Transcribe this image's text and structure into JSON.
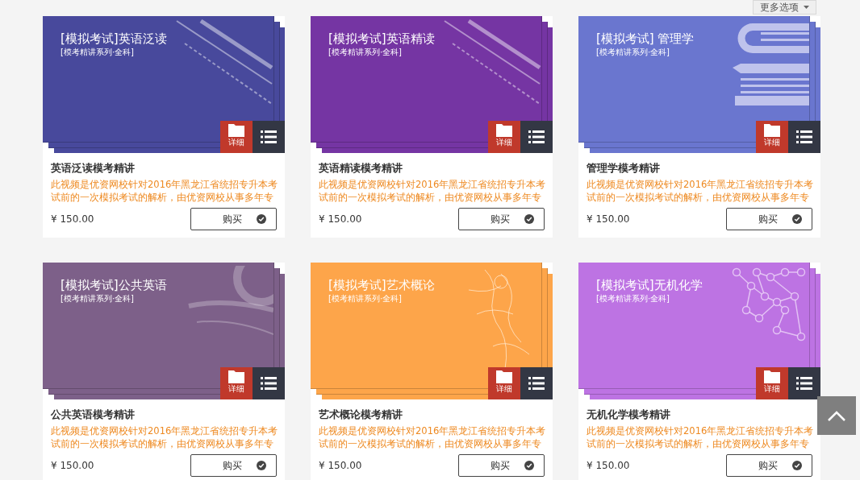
{
  "toolbar": {
    "options_button": "更多选项"
  },
  "courses": [
    {
      "cover_title": "[模拟考试]英语泛读",
      "cover_subtitle": "[模考精讲系列·全科]",
      "color": "#48499c",
      "kind": "script",
      "detail": "详细",
      "name": "英语泛读模考精讲",
      "description": "此视频是优资网校针对2016年黑龙江省统招专升本考试前的一次模拟考试的解析，由优资网校从事多年专",
      "price": "¥ 150.00",
      "buy": "购买"
    },
    {
      "cover_title": "[模拟考试]英语精读",
      "cover_subtitle": "[模考精讲系列·全科]",
      "color": "#7535a3",
      "kind": "script",
      "detail": "详细",
      "name": "英语精读模考精讲",
      "description": "此视频是优资网校针对2016年黑龙江省统招专升本考试前的一次模拟考试的解析，由优资网校从事多年专",
      "price": "¥ 150.00",
      "buy": "购买"
    },
    {
      "cover_title": "[模拟考试] 管理学",
      "cover_subtitle": "[模考精讲系列·全科]",
      "color": "#6a76cf",
      "kind": "books",
      "detail": "详细",
      "name": "管理学模考精讲",
      "description": "此视频是优资网校针对2016年黑龙江省统招专升本考试前的一次模拟考试的解析，由优资网校从事多年专",
      "price": "¥ 150.00",
      "buy": "购买"
    },
    {
      "cover_title": "[模拟考试]公共英语",
      "cover_subtitle": "[模考精讲系列·全科]",
      "color": "#7d6089",
      "kind": "letters",
      "detail": "详细",
      "name": "公共英语模考精讲",
      "description": "此视频是优资网校针对2016年黑龙江省统招专升本考试前的一次模拟考试的解析，由优资网校从事多年专",
      "price": "¥ 150.00",
      "buy": "购买"
    },
    {
      "cover_title": "[模拟考试]艺术概论",
      "cover_subtitle": "[模考精讲系列·全科]",
      "color": "#fda54a",
      "kind": "sketch",
      "detail": "详细",
      "name": "艺术概论模考精讲",
      "description": "此视频是优资网校针对2016年黑龙江省统招专升本考试前的一次模拟考试的解析，由优资网校从事多年专",
      "price": "¥ 150.00",
      "buy": "购买"
    },
    {
      "cover_title": "[模拟考试]无机化学",
      "cover_subtitle": "[模考精讲系列·全科]",
      "color": "#bd73e3",
      "kind": "network",
      "detail": "详细",
      "name": "无机化学模考精讲",
      "description": "此视频是优资网校针对2016年黑龙江省统招专升本考试前的一次模拟考试的解析，由优资网校从事多年专",
      "price": "¥ 150.00",
      "buy": "购买"
    }
  ]
}
